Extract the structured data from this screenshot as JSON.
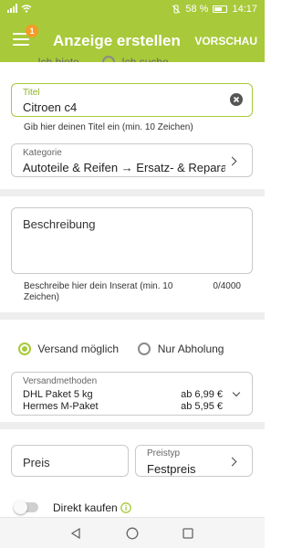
{
  "status": {
    "battery": "58 %",
    "time": "14:17"
  },
  "appbar": {
    "badge": "1",
    "title": "Anzeige erstellen",
    "preview": "VORSCHAU"
  },
  "offer": {
    "option1": "Ich biete",
    "option2": "Ich suche"
  },
  "title_field": {
    "label": "Titel",
    "value": "Citroen c4",
    "help": "Gib hier deinen Titel ein (min. 10 Zeichen)"
  },
  "category": {
    "label": "Kategorie",
    "value": "Autoteile & Reifen → Ersatz- & Reparaturte"
  },
  "description": {
    "placeholder": "Beschreibung",
    "help": "Beschreibe hier dein Inserat (min. 10 Zeichen)",
    "counter": "0/4000"
  },
  "shipping": {
    "option1": "Versand möglich",
    "option2": "Nur Abholung",
    "methods_label": "Versandmethoden",
    "methods": [
      {
        "name": "DHL Paket 5 kg",
        "price": "ab 6,99 €"
      },
      {
        "name": "Hermes M-Paket",
        "price": "ab 5,95 €"
      }
    ]
  },
  "price": {
    "placeholder": "Preis",
    "type_label": "Preistyp",
    "type_value": "Festpreis"
  },
  "buy_now": {
    "label": "Direkt kaufen"
  },
  "colors": {
    "brand": "#a8c93a",
    "badge": "#f39c24"
  }
}
